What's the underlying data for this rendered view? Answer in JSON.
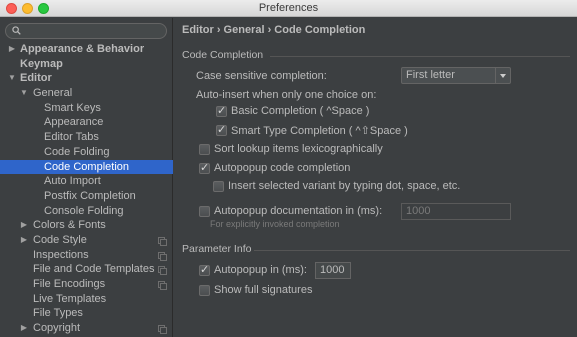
{
  "window": {
    "title": "Preferences"
  },
  "search": {
    "placeholder": ""
  },
  "sidebar": {
    "items": [
      {
        "label": "Appearance & Behavior",
        "expanded": false,
        "bold": true,
        "level": 0,
        "has_arrow": true
      },
      {
        "label": "Keymap",
        "bold": true,
        "level": 0,
        "has_arrow": false
      },
      {
        "label": "Editor",
        "expanded": true,
        "bold": true,
        "level": 0,
        "has_arrow": true
      },
      {
        "label": "General",
        "expanded": true,
        "level": 1,
        "has_arrow": true
      },
      {
        "label": "Smart Keys",
        "level": 2
      },
      {
        "label": "Appearance",
        "level": 2
      },
      {
        "label": "Editor Tabs",
        "level": 2
      },
      {
        "label": "Code Folding",
        "level": 2
      },
      {
        "label": "Code Completion",
        "level": 2,
        "selected": true
      },
      {
        "label": "Auto Import",
        "level": 2
      },
      {
        "label": "Postfix Completion",
        "level": 2
      },
      {
        "label": "Console Folding",
        "level": 2
      },
      {
        "label": "Colors & Fonts",
        "level": 1,
        "has_arrow": true
      },
      {
        "label": "Code Style",
        "level": 1,
        "has_arrow": true,
        "copy_icon": true
      },
      {
        "label": "Inspections",
        "level": 1,
        "copy_icon": true
      },
      {
        "label": "File and Code Templates",
        "level": 1,
        "copy_icon": true
      },
      {
        "label": "File Encodings",
        "level": 1,
        "copy_icon": true
      },
      {
        "label": "Live Templates",
        "level": 1
      },
      {
        "label": "File Types",
        "level": 1
      },
      {
        "label": "Copyright",
        "level": 1,
        "has_arrow": true,
        "copy_icon": true
      }
    ]
  },
  "main": {
    "breadcrumb": "Editor › General › Code Completion",
    "code_completion": {
      "section_title": "Code Completion",
      "case_sensitive_label": "Case sensitive completion:",
      "case_sensitive_value": "First letter",
      "auto_insert_label": "Auto-insert when only one choice on:",
      "basic_completion": {
        "label": "Basic Completion ( ^Space )",
        "checked": true
      },
      "smart_type_completion": {
        "label": "Smart Type Completion ( ^⇧Space )",
        "checked": true
      },
      "sort_lexicographically": {
        "label": "Sort lookup items lexicographically",
        "checked": false
      },
      "autopopup_code_completion": {
        "label": "Autopopup code completion",
        "checked": true
      },
      "insert_selected_variant": {
        "label": "Insert selected variant by typing dot, space, etc.",
        "checked": false
      },
      "autopopup_documentation": {
        "label": "Autopopup documentation in (ms):",
        "checked": false,
        "value": "1000"
      },
      "autopopup_documentation_hint": "For explicitly invoked completion"
    },
    "parameter_info": {
      "section_title": "Parameter Info",
      "autopopup_in": {
        "label": "Autopopup in (ms):",
        "checked": true,
        "value": "1000"
      },
      "show_full_signatures": {
        "label": "Show full signatures",
        "checked": false
      }
    }
  },
  "colors": {
    "selection": "#2f65ca",
    "panel": "#3c3f41",
    "text": "#bbbbbb"
  }
}
